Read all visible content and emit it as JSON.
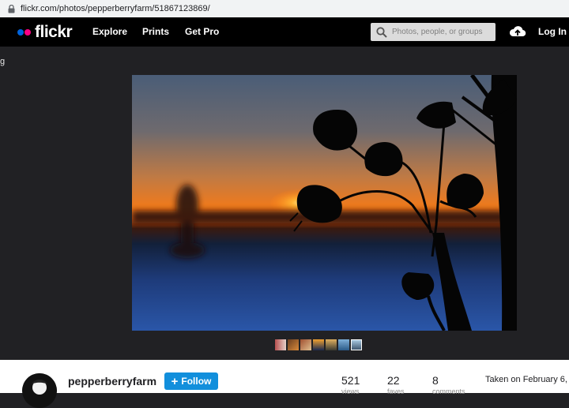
{
  "browser": {
    "url": "flickr.com/photos/pepperberryfarm/51867123869/"
  },
  "header": {
    "logo_text": "flickr",
    "logo_colors": {
      "blue": "#0063dc",
      "pink": "#ff0084"
    },
    "nav": {
      "explore": "Explore",
      "prints": "Prints",
      "get_pro": "Get Pro"
    },
    "search_placeholder": "Photos, people, or groups",
    "login_label": "Log In"
  },
  "side_glyph": "g",
  "photo": {
    "description_icon": "sunset-silhouette-photo",
    "thumbnail_count": 7
  },
  "owner": {
    "name": "pepperberryfarm",
    "follow_label": "Follow"
  },
  "stats": [
    {
      "value": "521",
      "label": "views"
    },
    {
      "value": "22",
      "label": "faves"
    },
    {
      "value": "8",
      "label": "comments"
    }
  ],
  "taken": "Taken on February 6,",
  "colors": {
    "accent": "#128fdc",
    "nav_bg": "#000000",
    "page_bg": "#212124"
  }
}
